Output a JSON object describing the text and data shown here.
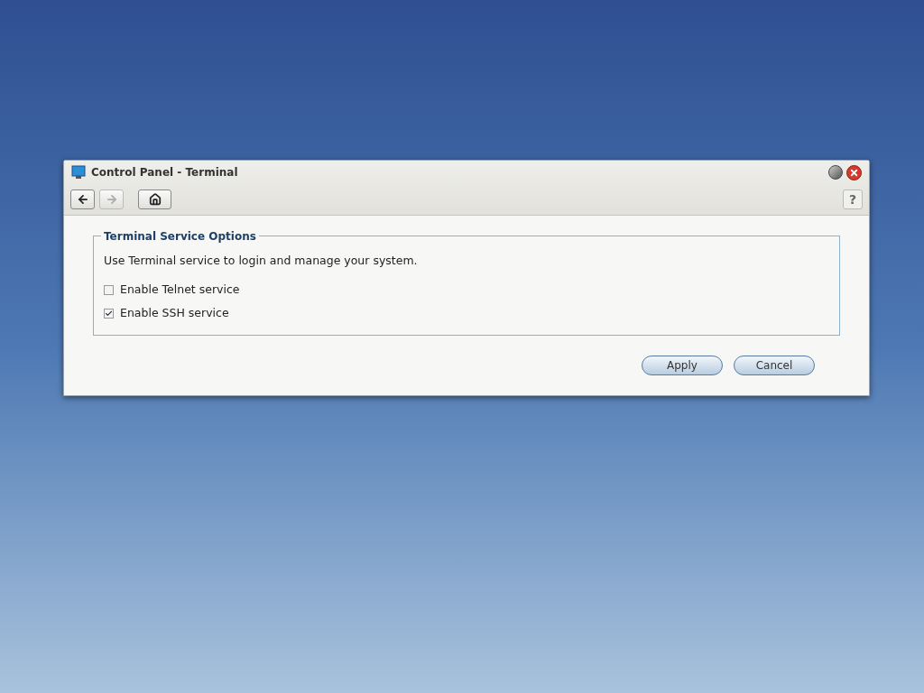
{
  "window": {
    "title": "Control Panel - Terminal"
  },
  "toolbar": {
    "buttons": [
      {
        "kind": "back",
        "disabled": false
      },
      {
        "kind": "forward",
        "disabled": true
      },
      {
        "kind": "home",
        "disabled": false
      }
    ],
    "help": "?"
  },
  "group": {
    "legend": "Terminal Service Options",
    "description": "Use Terminal service to login and manage your system.",
    "options": [
      {
        "label": "Enable Telnet service",
        "checked": false
      },
      {
        "label": "Enable SSH service",
        "checked": true
      }
    ]
  },
  "buttons": [
    "Apply",
    "Cancel"
  ]
}
